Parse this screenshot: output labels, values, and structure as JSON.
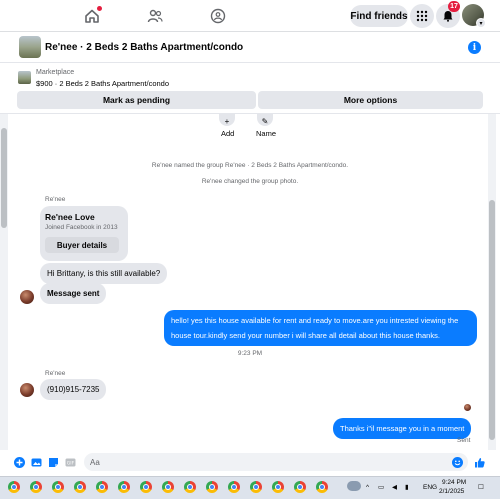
{
  "nav": {
    "home_icon": "home-icon",
    "friends_icon": "friends-icon",
    "groups_icon": "groups-icon",
    "find_friends_label": "Find friends",
    "menu_icon": "grid-menu-icon",
    "notifications_icon": "bell-icon",
    "notifications_count": "17"
  },
  "chat": {
    "title": "Re'nee · 2 Beds 2 Baths Apartment/condo",
    "info_icon": "info-icon"
  },
  "marketplace": {
    "label": "Marketplace",
    "listing": "$900 · 2 Beds 2 Baths Apartment/condo",
    "mark_pending": "Mark as pending",
    "more_options": "More options"
  },
  "actions": {
    "add": "Add",
    "name": "Name"
  },
  "system_messages": [
    "Re'nee named the group Re'nee · 2 Beds 2 Baths Apartment/condo.",
    "Re'nee changed the group photo."
  ],
  "thread": {
    "sender": "Re'nee",
    "card_name": "Re'nee Love",
    "card_joined": "Joined Facebook in 2013",
    "card_button": "Buyer details",
    "msg1": "Hi Brittany, is this still available?",
    "msg2": "Message sent",
    "out1": "hello! yes this house available for rent and ready to move.are you intrested viewing the house tour.kindly send your number i will share all detail about this house thanks.",
    "time": "9:23 PM",
    "sender2": "Re'nee",
    "msg3": "(910)915-7235",
    "out2": "Thanks i\"il message you in a moment",
    "status": "Sent"
  },
  "composer": {
    "placeholder": "Aa"
  },
  "taskbar": {
    "lang": "ENG",
    "time": "9:24 PM",
    "date": "2/1/2025"
  },
  "colors": {
    "accent": "#0a7cff",
    "badge": "#e41e3f"
  }
}
